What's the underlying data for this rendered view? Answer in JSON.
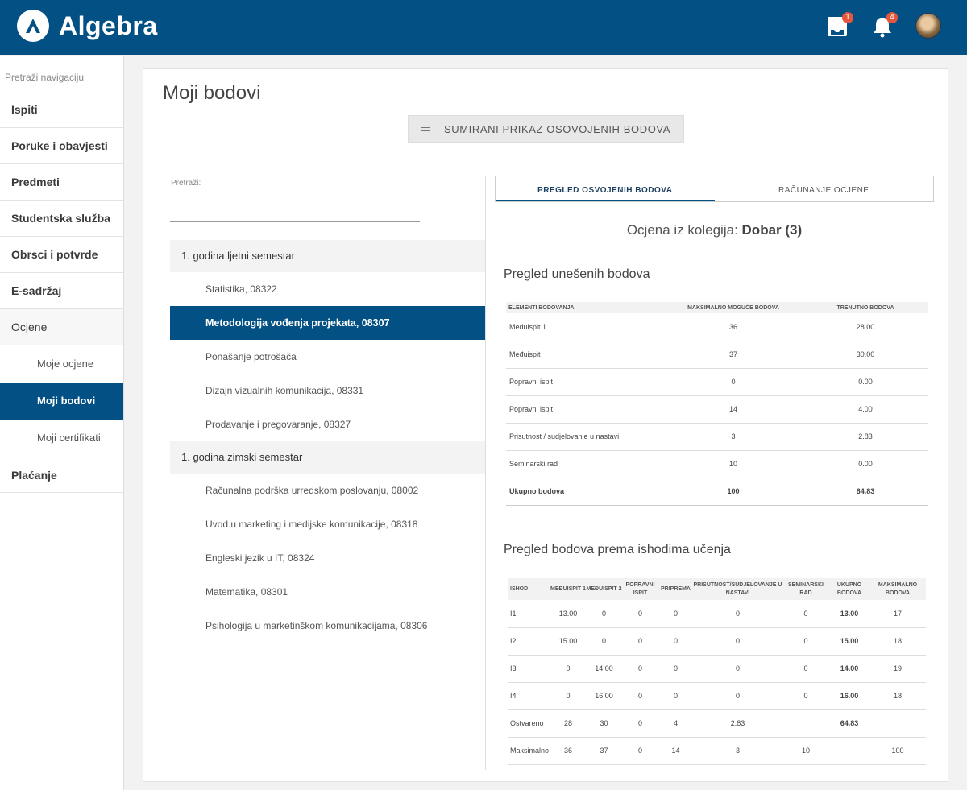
{
  "header": {
    "brand": "Algebra",
    "inbox_badge": "1",
    "notifications_badge": "4"
  },
  "sidebar": {
    "search_placeholder": "Pretraži navigaciju",
    "items": [
      {
        "label": "Ispiti"
      },
      {
        "label": "Poruke i obavjesti"
      },
      {
        "label": "Predmeti"
      },
      {
        "label": "Studentska služba"
      },
      {
        "label": "Obrsci i potvrde"
      },
      {
        "label": "E-sadržaj"
      },
      {
        "label": "Ocjene"
      }
    ],
    "sub_items": [
      {
        "label": "Moje ocjene"
      },
      {
        "label": "Moji bodovi"
      },
      {
        "label": "Moji certifikati"
      }
    ],
    "last_item": "Plaćanje"
  },
  "main": {
    "title": "Moji bodovi",
    "summary_button": "SUMIRANI PRIKAZ OSOVOJENIH BODOVA",
    "search_label": "Pretraži:",
    "groups": [
      {
        "label": "1. godina ljetni semestar",
        "courses": [
          "Statistika, 08322",
          "Metodologija vođenja projekata, 08307",
          "Ponašanje potrošača",
          "Dizajn vizualnih komunikacija, 08331",
          "Prodavanje i pregovaranje, 08327"
        ]
      },
      {
        "label": "1. godina zimski semestar",
        "courses": [
          "Računalna podrška urredskom poslovanju, 08002",
          "Uvod u marketing i medijske komunikacije, 08318",
          "Engleski jezik u IT, 08324",
          "Matematika, 08301",
          "Psihologija u marketinškom komunikacijama, 08306"
        ]
      }
    ],
    "tabs": [
      "PREGLED OSVOJENIH BODOVA",
      "RAČUNANJE OCJENE"
    ],
    "grade_prefix": "Ocjena iz kolegija:",
    "grade_value": "Dobar (3)",
    "points_title": "Pregled unešenih bodova",
    "points_headers": [
      "ELEMENTI BODOVANJA",
      "MAKSIMALNO MOGUĆE BODOVA",
      "TRENUTNO BODOVA"
    ],
    "points_rows": [
      [
        "Međuispit 1",
        "36",
        "28.00"
      ],
      [
        "Međuispit",
        "37",
        "30.00"
      ],
      [
        "Popravni ispit",
        "0",
        "0.00"
      ],
      [
        "Popravni ispit",
        "14",
        "4.00"
      ],
      [
        "Prisutnost / sudjelovanje u nastavi",
        "3",
        "2.83"
      ],
      [
        "Seminarski rad",
        "10",
        "0.00"
      ],
      [
        "Ukupno bodova",
        "100",
        "64.83"
      ]
    ],
    "outcomes_title": "Pregled bodova prema ishodima učenja",
    "outcomes_headers": [
      "ISHOD",
      "MEĐUISPIT 1",
      "MEĐUISPIT 2",
      "POPRAVNI ISPIT",
      "PRIPREMA",
      "PRISUTNOST/SUDJELOVANJE U NASTAVI",
      "SEMINARSKI RAD",
      "UKUPNO BODOVA",
      "MAKSIMALNO BODOVA"
    ],
    "outcomes_rows": [
      [
        "I1",
        "13.00",
        "0",
        "0",
        "0",
        "0",
        "0",
        "13.00",
        "17"
      ],
      [
        "I2",
        "15.00",
        "0",
        "0",
        "0",
        "0",
        "0",
        "15.00",
        "18"
      ],
      [
        "I3",
        "0",
        "14.00",
        "0",
        "0",
        "0",
        "0",
        "14.00",
        "19"
      ],
      [
        "I4",
        "0",
        "16.00",
        "0",
        "0",
        "0",
        "0",
        "16.00",
        "18"
      ],
      [
        "Ostvareno",
        "28",
        "30",
        "0",
        "4",
        "2.83",
        "",
        "64.83",
        ""
      ],
      [
        "Maksimalno",
        "36",
        "37",
        "0",
        "14",
        "3",
        "10",
        "",
        "100"
      ]
    ]
  }
}
